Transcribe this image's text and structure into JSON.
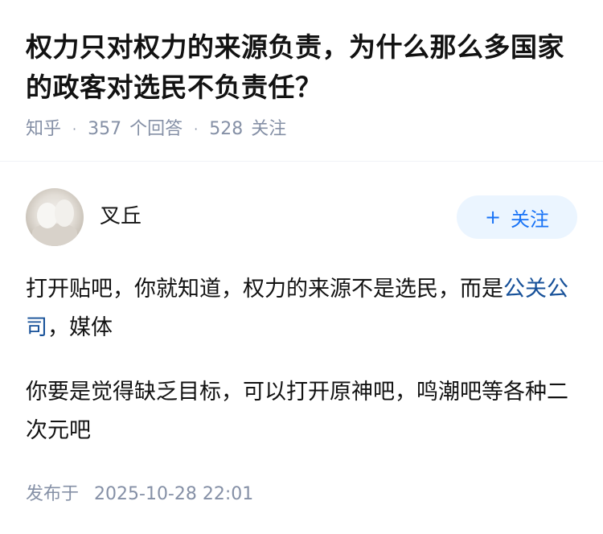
{
  "question": {
    "title": "权力只对权力的来源负责，为什么那么多国家的政客对选民不负责任？",
    "source": "知乎",
    "dot": "·",
    "answer_count": "357",
    "answer_label": "个回答",
    "follower_count": "528",
    "follower_label": "关注"
  },
  "answer": {
    "author": "叉丘",
    "follow_plus": "+",
    "follow_label": "关注",
    "p1_before": "打开贴吧，你就知道，权力的来源不是选民，而是",
    "p1_link": "公关公司",
    "p1_after": "，媒体",
    "p2": "你要是觉得缺乏目标，可以打开原神吧，鸣潮吧等各种二次元吧",
    "publish_label": "发布于",
    "publish_time": "2025-10-28 22:01"
  },
  "colors": {
    "link": "#175199",
    "accent": "#1772f6",
    "meta": "#8590a6"
  }
}
